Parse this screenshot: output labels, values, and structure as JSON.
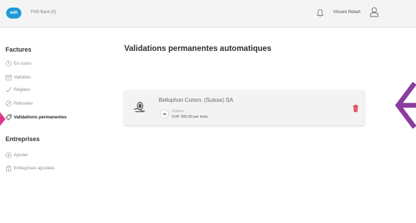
{
  "header": {
    "logo_text": "edit",
    "bank_name": "FNS Bank (fr)",
    "user_name": "Vincent Robert"
  },
  "sidebar": {
    "sections": [
      {
        "title": "Factures",
        "items": [
          {
            "label": "En cours",
            "icon": "clock-icon",
            "active": false
          },
          {
            "label": "Validées",
            "icon": "calendar-icon",
            "active": false
          },
          {
            "label": "Réglées",
            "icon": "check-icon",
            "active": false
          },
          {
            "label": "Refusées",
            "icon": "forbidden-icon",
            "active": false
          },
          {
            "label": "Validations permanentes",
            "icon": "tag-icon",
            "active": true
          }
        ]
      },
      {
        "title": "Entreprises",
        "items": [
          {
            "label": "Ajouter",
            "icon": "plus-circle-icon",
            "active": false
          },
          {
            "label": "Entreprises ajoutées",
            "icon": "building-icon",
            "active": false
          }
        ]
      }
    ]
  },
  "main": {
    "title": "Validations permanentes automatiques",
    "validations": [
      {
        "company": "Bellophon Comm. (Suisse) SA",
        "badge": "eB",
        "type": "Plafond",
        "amount": "CHF 300,00 par mois"
      }
    ]
  },
  "colors": {
    "accent": "#8a3d9e",
    "pink_arrow": "#e0368a",
    "delete": "#d9363e",
    "logo": "#1f9ad6"
  }
}
